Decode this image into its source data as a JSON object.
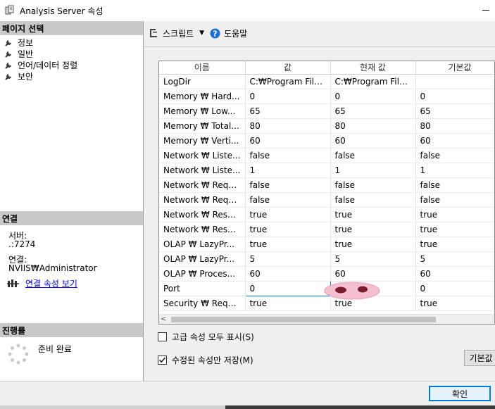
{
  "window": {
    "title": "Analysis Server 속성"
  },
  "sidebar": {
    "page_select_header": "페이지 선택",
    "items": [
      {
        "label": "정보"
      },
      {
        "label": "일반"
      },
      {
        "label": "언어/데이터 정렬"
      },
      {
        "label": "보안"
      }
    ],
    "connection_header": "연결",
    "server_label": "서버:",
    "server_value": ".:7274",
    "connection_label": "연결:",
    "connection_value": "NVIIS₩Administrator",
    "view_connection_link": "연결 속성 보기",
    "progress_header": "진행률",
    "progress_status": "준비 완료"
  },
  "toolbar": {
    "script_label": "스크립트",
    "help_label": "도움말"
  },
  "grid": {
    "columns": [
      "이름",
      "값",
      "현재 값",
      "기본값"
    ],
    "rows": [
      [
        "LogDir",
        "C:₩Program File...",
        "C:₩Program File...",
        ""
      ],
      [
        "Memory ₩ Hard...",
        "0",
        "0",
        "0"
      ],
      [
        "Memory ₩ Low...",
        "65",
        "65",
        "65"
      ],
      [
        "Memory ₩ Total...",
        "80",
        "80",
        "80"
      ],
      [
        "Memory ₩ Verti...",
        "60",
        "60",
        "60"
      ],
      [
        "Network ₩ Liste...",
        "false",
        "false",
        "false"
      ],
      [
        "Network ₩ Liste...",
        "1",
        "1",
        "1"
      ],
      [
        "Network ₩ Requ...",
        "false",
        "false",
        "false"
      ],
      [
        "Network ₩ Requ...",
        "false",
        "false",
        "false"
      ],
      [
        "Network ₩ Resp...",
        "true",
        "true",
        "true"
      ],
      [
        "Network ₩ Resp...",
        "true",
        "true",
        "true"
      ],
      [
        "OLAP ₩ LazyPr...",
        "true",
        "true",
        "true"
      ],
      [
        "OLAP ₩ LazyPr...",
        "5",
        "5",
        "5"
      ],
      [
        "OLAP ₩ Proces...",
        "60",
        "60",
        "60"
      ],
      [
        "Port",
        "0",
        "",
        "0"
      ],
      [
        "Security ₩ Requ...",
        "true",
        "true",
        "true"
      ]
    ],
    "editing_row": 14
  },
  "options": {
    "show_advanced_label": "고급 속성 모두 표시(S)",
    "show_advanced_checked": false,
    "save_modified_label": "수정된 속성만 저장(M)",
    "save_modified_checked": true
  },
  "buttons": {
    "default_label": "기본값",
    "ok_label": "확인"
  },
  "colors": {
    "header_bg": "#c9c9c9",
    "link": "#0000ee",
    "accent": "#0078d7",
    "help_icon": "#1e73d2"
  }
}
